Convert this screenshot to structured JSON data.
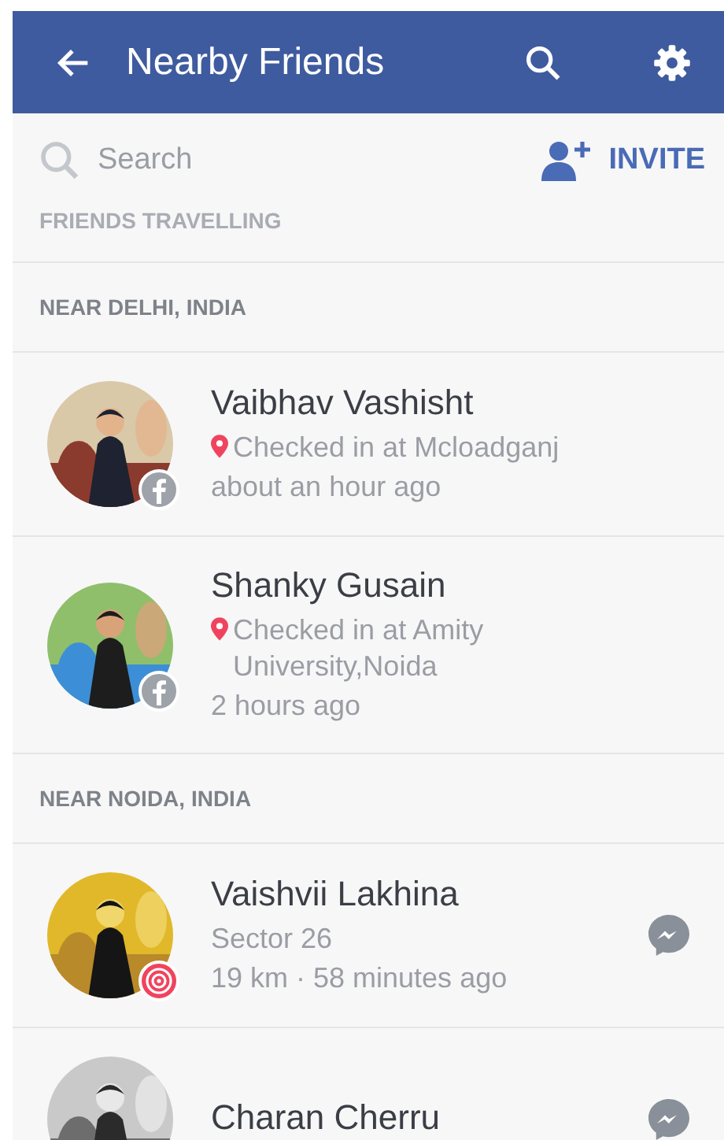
{
  "app_bar": {
    "title": "Nearby Friends"
  },
  "search": {
    "placeholder": "Search"
  },
  "invite": {
    "label": "INVITE"
  },
  "sections": [
    {
      "title": "FRIENDS TRAVELLING"
    },
    {
      "title": "NEAR DELHI, INDIA",
      "friends": [
        {
          "name": "Vaibhav Vashisht",
          "kind": "facebook",
          "lines": [
            {
              "kind": "checkin",
              "text": "Checked in at Mcloadganj"
            },
            {
              "kind": "plain",
              "text": "about an hour ago"
            }
          ],
          "messenger": false
        },
        {
          "name": "Shanky Gusain",
          "kind": "facebook",
          "lines": [
            {
              "kind": "checkin",
              "text": "Checked in at Amity University,Noida"
            },
            {
              "kind": "plain",
              "text": "2 hours ago"
            }
          ],
          "messenger": false
        }
      ]
    },
    {
      "title": "NEAR NOIDA, INDIA",
      "friends": [
        {
          "name": "Vaishvii Lakhina",
          "kind": "nearby",
          "lines": [
            {
              "kind": "plain",
              "text": "Sector 26"
            },
            {
              "kind": "plain",
              "text": "19 km · 58 minutes ago"
            }
          ],
          "messenger": true
        },
        {
          "name": "Charan Cherru",
          "kind": "plain",
          "messenger": true
        }
      ]
    }
  ]
}
